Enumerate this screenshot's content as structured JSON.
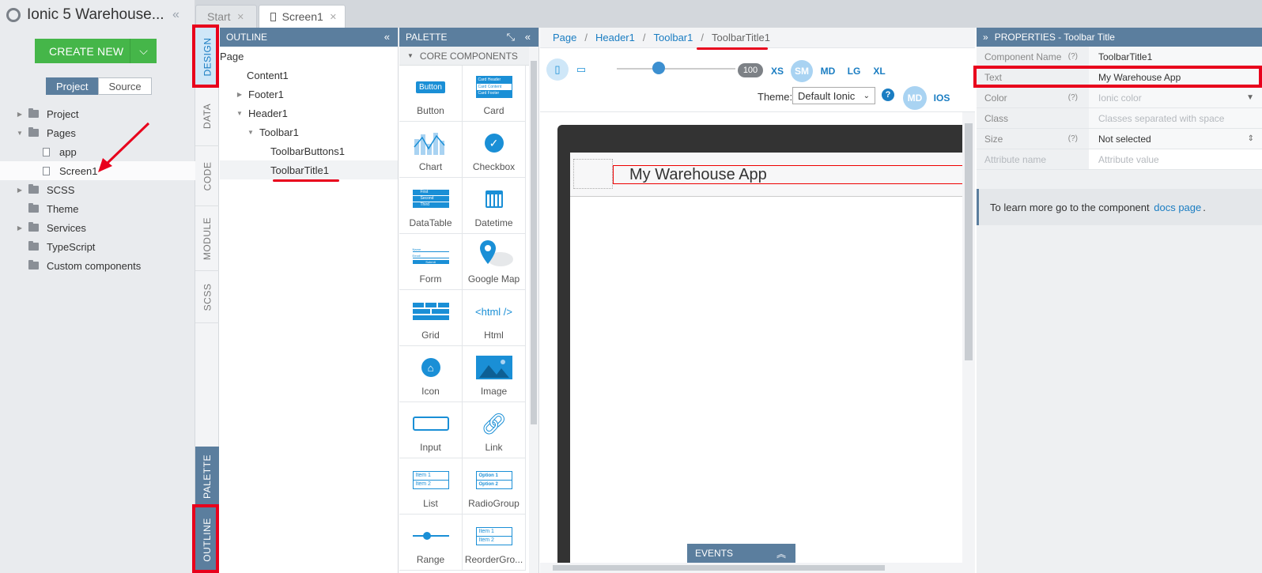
{
  "app": {
    "title": "Ionic 5 Warehouse..."
  },
  "left": {
    "create_label": "CREATE NEW",
    "segments": [
      {
        "label": "Project"
      },
      {
        "label": "Source"
      }
    ],
    "tree": [
      {
        "label": "Project"
      },
      {
        "label": "Pages"
      },
      {
        "label": "app"
      },
      {
        "label": "Screen1"
      },
      {
        "label": "SCSS"
      },
      {
        "label": "Theme"
      },
      {
        "label": "Services"
      },
      {
        "label": "TypeScript"
      },
      {
        "label": "Custom components"
      }
    ]
  },
  "tabs": [
    {
      "label": "Start"
    },
    {
      "label": "Screen1"
    }
  ],
  "vtabs": [
    "DESIGN",
    "DATA",
    "CODE",
    "MODULE",
    "SCSS",
    "PALETTE",
    "OUTLINE"
  ],
  "outline": {
    "title": "OUTLINE",
    "items": [
      "Page",
      "Content1",
      "Footer1",
      "Header1",
      "Toolbar1",
      "ToolbarButtons1",
      "ToolbarTitle1"
    ]
  },
  "palette": {
    "title": "PALETTE",
    "section": "CORE COMPONENTS",
    "items": [
      {
        "label": "Button",
        "icon": "button-icon"
      },
      {
        "label": "Card",
        "icon": "card-icon"
      },
      {
        "label": "Chart",
        "icon": "chart-icon"
      },
      {
        "label": "Checkbox",
        "icon": "checkbox-icon"
      },
      {
        "label": "DataTable",
        "icon": "datatable-icon"
      },
      {
        "label": "Datetime",
        "icon": "calendar-icon"
      },
      {
        "label": "Form",
        "icon": "form-icon"
      },
      {
        "label": "Google Map",
        "icon": "map-pin-icon"
      },
      {
        "label": "Grid",
        "icon": "grid-icon"
      },
      {
        "label": "Html",
        "icon": "html-icon"
      },
      {
        "label": "Icon",
        "icon": "home-icon"
      },
      {
        "label": "Image",
        "icon": "image-icon"
      },
      {
        "label": "Input",
        "icon": "input-icon"
      },
      {
        "label": "Link",
        "icon": "link-icon"
      },
      {
        "label": "List",
        "icon": "list-icon"
      },
      {
        "label": "RadioGroup",
        "icon": "radio-icon"
      },
      {
        "label": "Range",
        "icon": "range-icon"
      },
      {
        "label": "ReorderGro...",
        "icon": "reorder-icon"
      }
    ],
    "icon_texts": {
      "button": "Button",
      "html": "<html />",
      "card": [
        "Card Header",
        "Card Content",
        "Card Footer"
      ],
      "datatable": [
        "First",
        "Second",
        "Third"
      ],
      "form": [
        "Name",
        "Email",
        "Submit"
      ],
      "list": [
        "Item 1",
        "Item 2"
      ],
      "radio": [
        "Option 1",
        "Option 2"
      ],
      "reorder": [
        "Item 1",
        "Item 2"
      ]
    }
  },
  "canvas": {
    "breadcrumbs": [
      "Page",
      "Header1",
      "Toolbar1",
      "ToolbarTitle1"
    ],
    "zoom": "100",
    "breakpoints": [
      "XS",
      "SM",
      "MD",
      "LG",
      "XL"
    ],
    "theme_label": "Theme:",
    "theme_value": "Default Ionic",
    "modes": [
      "MD",
      "IOS"
    ],
    "toolbar_title": "My Warehouse App",
    "events_label": "EVENTS"
  },
  "props": {
    "title": "PROPERTIES - Toolbar Title",
    "rows": [
      {
        "key": "Component Name",
        "q": "(?)",
        "value": "ToolbarTitle1"
      },
      {
        "key": "Text",
        "q": "",
        "value": "My Warehouse App"
      },
      {
        "key": "Color",
        "q": "(?)",
        "value": "Ionic color"
      },
      {
        "key": "Class",
        "q": "",
        "value": "Classes separated with space"
      },
      {
        "key": "Size",
        "q": "(?)",
        "value": "Not selected"
      },
      {
        "key": "Attribute name",
        "q": "",
        "value": "Attribute value"
      }
    ],
    "info_prefix": "To learn more go to the component",
    "info_link": "docs page",
    "info_suffix": "."
  },
  "colors": {
    "accent": "#1a7dc2",
    "header": "#5b7e9e",
    "create": "#45b649",
    "highlight": "#e8001c"
  }
}
